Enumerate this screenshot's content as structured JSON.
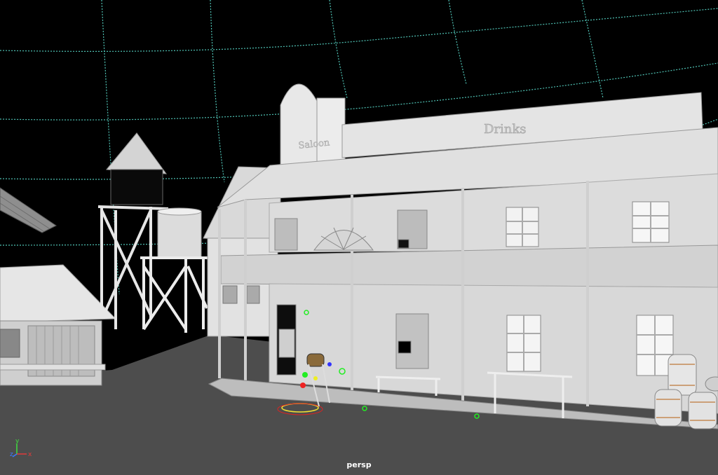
{
  "viewport": {
    "camera_label": "persp",
    "background_color": "#000000",
    "ground_color": "#4d4d4d",
    "grid_color": "#5fd1c4"
  },
  "scene": {
    "saloon_sign_text": "Drinks",
    "hotel_sign_text": "Saloon"
  },
  "axis_gizmo": {
    "x_label": "x",
    "y_label": "y",
    "z_label": "z",
    "x_color": "#e23b3b",
    "y_color": "#3ee03e",
    "z_color": "#3a7bff"
  }
}
